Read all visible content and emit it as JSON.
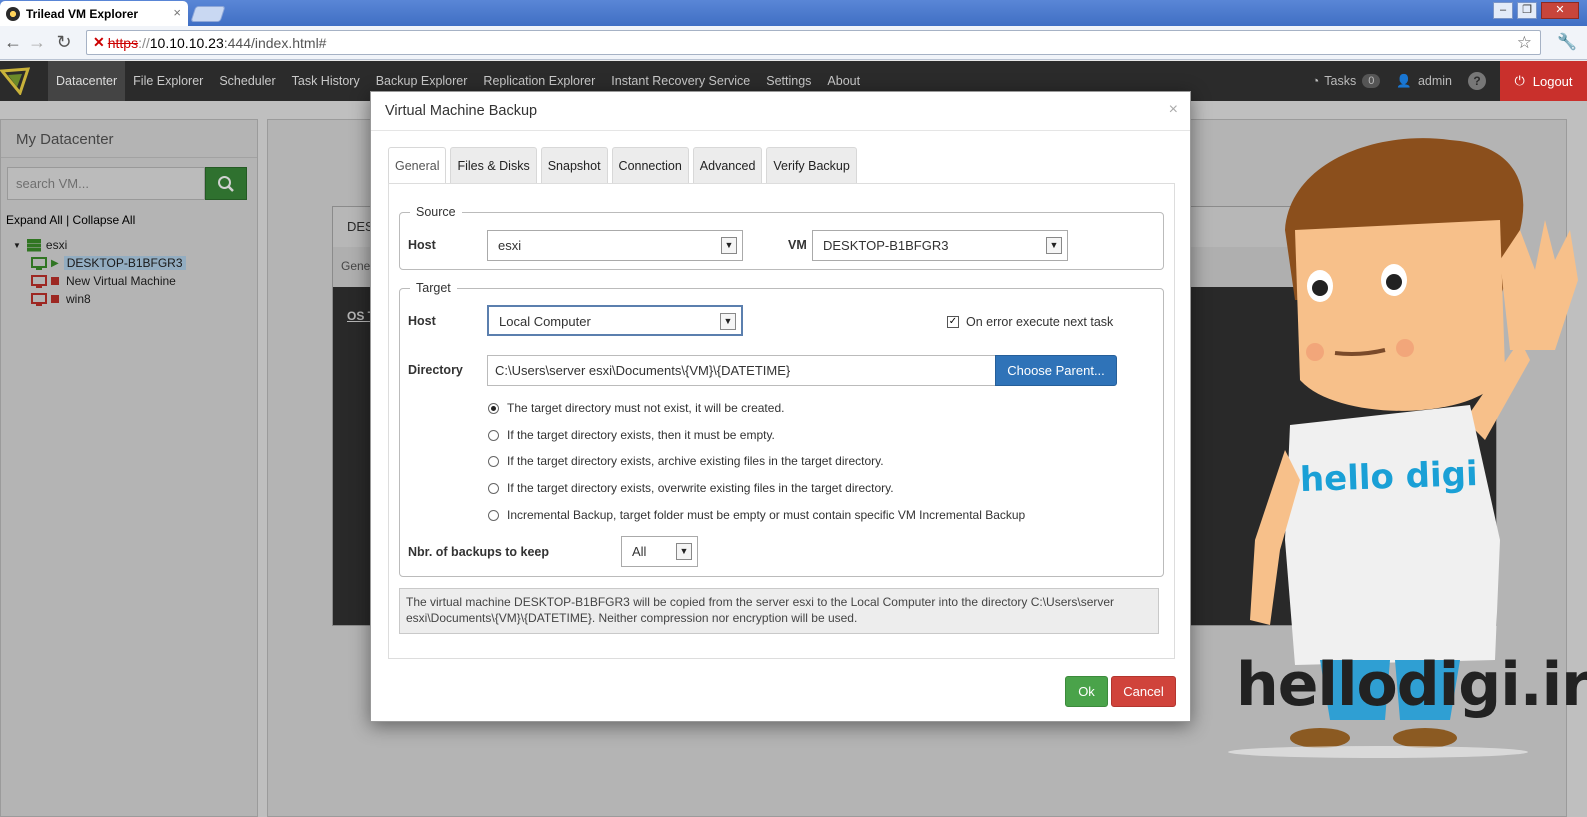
{
  "browser": {
    "tab_title": "Trilead VM Explorer",
    "tab_close": "×",
    "url_protocol": "https",
    "url_host": "10.10.10.23",
    "url_path": ":444/index.html#",
    "window_buttons": [
      "0",
      "1",
      "r"
    ]
  },
  "appnav": {
    "menu": [
      "Datacenter",
      "File Explorer",
      "Scheduler",
      "Task History",
      "Backup Explorer",
      "Replication Explorer",
      "Instant Recovery Service",
      "Settings",
      "About"
    ],
    "tasks_label": "Tasks",
    "tasks_count": "0",
    "user": "admin",
    "help": "?",
    "logout": "Logout"
  },
  "left": {
    "title": "My Datacenter",
    "search_placeholder": "search VM...",
    "expand_all": "Expand All",
    "separator": "|",
    "collapse_all": "Collapse All",
    "tree": {
      "host": "esxi",
      "vms": [
        {
          "name": "DESKTOP-B1BFGR3",
          "state": "running"
        },
        {
          "name": "New Virtual Machine",
          "state": "stopped"
        },
        {
          "name": "win8",
          "state": "stopped"
        }
      ]
    }
  },
  "background": {
    "panel_title": "DES",
    "panel_tab": "Gene",
    "os_label": "OS T"
  },
  "modal": {
    "title": "Virtual Machine Backup",
    "close": "×",
    "tabs": [
      "General",
      "Files & Disks",
      "Snapshot",
      "Connection",
      "Advanced",
      "Verify Backup"
    ],
    "source": {
      "legend": "Source",
      "host_label": "Host",
      "host_value": "esxi",
      "vm_label": "VM",
      "vm_value": "DESKTOP-B1BFGR3"
    },
    "target": {
      "legend": "Target",
      "host_label": "Host",
      "host_value": "Local Computer",
      "on_error_label": "On error execute next task",
      "on_error_checked": true,
      "directory_label": "Directory",
      "directory_value": "C:\\Users\\server esxi\\Documents\\{VM}\\{DATETIME}",
      "choose_parent": "Choose Parent...",
      "options": [
        "The target directory must not exist, it will be created.",
        "If the target directory exists, then it must be empty.",
        "If the target directory exists, archive existing files in the target directory.",
        "If the target directory exists, overwrite existing files in the target directory.",
        "Incremental Backup, target folder must be empty or must contain specific VM Incremental Backup"
      ],
      "selected_option": 0,
      "keep_label": "Nbr. of backups to keep",
      "keep_value": "All"
    },
    "summary": "The virtual machine DESKTOP-B1BFGR3 will be copied from the server esxi to the Local Computer into the directory C:\\Users\\server esxi\\Documents\\{VM}\\{DATETIME}. Neither compression nor encryption will be used.",
    "ok": "Ok",
    "cancel": "Cancel"
  },
  "watermark": {
    "shirt_text": "hello digi",
    "site": "hellodigi.ir"
  }
}
